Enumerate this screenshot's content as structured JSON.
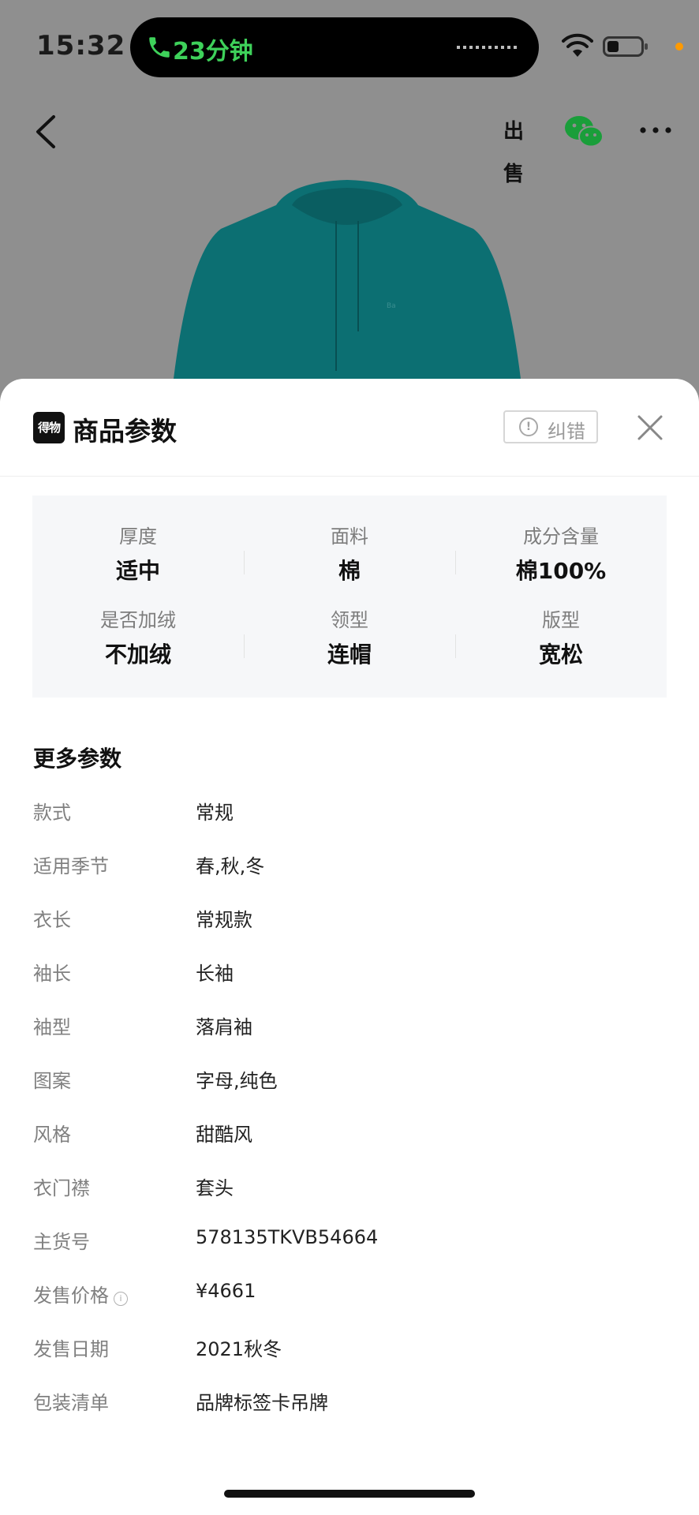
{
  "status_bar": {
    "time": "15:32",
    "call_duration": "23分钟",
    "icons": [
      "phone-icon",
      "wifi-icon",
      "battery-icon"
    ]
  },
  "nav": {
    "icons": [
      "back-icon",
      "sell-icon",
      "wechat-icon",
      "more-icon"
    ],
    "sell_label": "出售"
  },
  "sheet": {
    "brand_logo_text": "得物",
    "title": "商品参数",
    "report_label": "纠错",
    "key_params": [
      {
        "label": "厚度",
        "value": "适中"
      },
      {
        "label": "面料",
        "value": "棉"
      },
      {
        "label": "成分含量",
        "value": "棉100%"
      },
      {
        "label": "是否加绒",
        "value": "不加绒"
      },
      {
        "label": "领型",
        "value": "连帽"
      },
      {
        "label": "版型",
        "value": "宽松"
      }
    ],
    "more_title": "更多参数",
    "more_params": [
      {
        "label": "款式",
        "value": "常规"
      },
      {
        "label": "适用季节",
        "value": "春,秋,冬"
      },
      {
        "label": "衣长",
        "value": "常规款"
      },
      {
        "label": "袖长",
        "value": "长袖"
      },
      {
        "label": "袖型",
        "value": "落肩袖"
      },
      {
        "label": "图案",
        "value": "字母,纯色"
      },
      {
        "label": "风格",
        "value": "甜酷风"
      },
      {
        "label": "衣门襟",
        "value": "套头"
      },
      {
        "label": "主货号",
        "value": "578135TKVB54664"
      },
      {
        "label": "发售价格",
        "value": "¥4661"
      },
      {
        "label": "发售日期",
        "value": "2021秋冬"
      },
      {
        "label": "包装清单",
        "value": "品牌标签卡吊牌"
      }
    ]
  },
  "colors": {
    "product": "#0e7d7f",
    "call_green": "#3ed15a",
    "overlay": "#8f8f8f"
  }
}
